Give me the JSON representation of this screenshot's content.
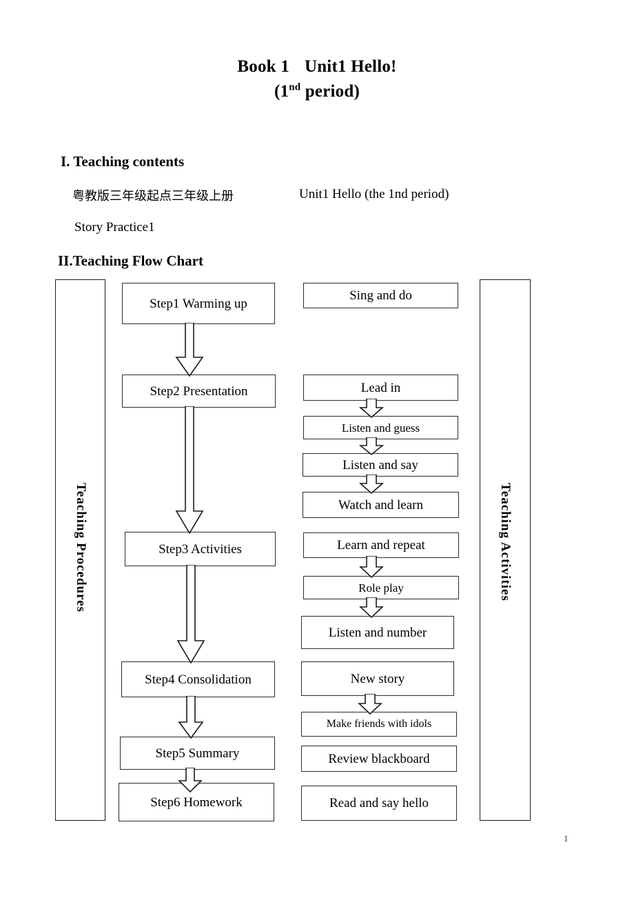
{
  "document": {
    "title_line1": "Book 1",
    "title_line1b": "Unit1 Hello!",
    "title_period_open": "(1",
    "title_period_sup": "nd",
    "title_period_rest": " period)",
    "page_number": "1"
  },
  "sections": {
    "teaching_contents": {
      "heading": "I. Teaching contents",
      "textbook_cn": "粤教版三年级起点三年级上册",
      "unit_en": "Unit1 Hello (the 1nd period)",
      "materials": "Story    Practice1"
    },
    "flow_chart": {
      "heading": "II.Teaching Flow Chart",
      "left_column_label": "Teaching  Procedures",
      "right_column_label": "Teaching  Activities",
      "steps": [
        {
          "label": "Step1 Warming up"
        },
        {
          "label": "Step2 Presentation"
        },
        {
          "label": "Step3 Activities"
        },
        {
          "label": "Step4 Consolidation"
        },
        {
          "label": "Step5 Summary"
        },
        {
          "label": "Step6 Homework"
        }
      ],
      "activities": [
        {
          "label": "Sing and do"
        },
        {
          "label": "Lead in"
        },
        {
          "label": "Listen and guess"
        },
        {
          "label": "Listen and say"
        },
        {
          "label": "Watch and learn"
        },
        {
          "label": "Learn and repeat"
        },
        {
          "label": "Role play"
        },
        {
          "label": "Listen and number"
        },
        {
          "label": "New story"
        },
        {
          "label": "Make friends with idols"
        },
        {
          "label": "Review blackboard"
        },
        {
          "label": "Read and say hello"
        }
      ]
    }
  },
  "style": {
    "ink": "#000000",
    "border": "#2b2b2b",
    "paper": "#ffffff"
  }
}
